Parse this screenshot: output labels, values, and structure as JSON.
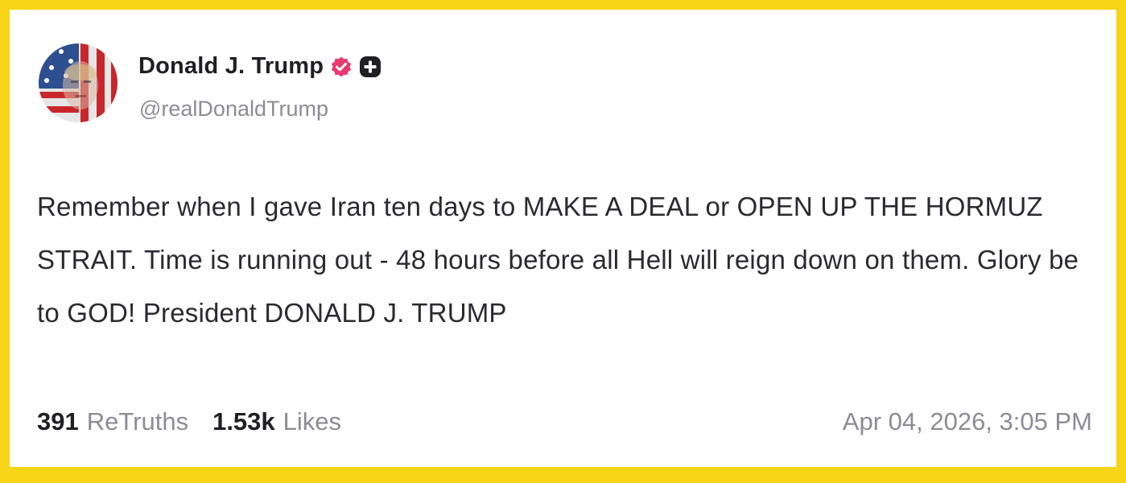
{
  "post": {
    "author_name": "Donald J. Trump",
    "author_handle": "@realDonaldTrump",
    "verified_icon": "verified-badge-icon",
    "subscribe_icon": "plus-icon",
    "avatar_icon": "profile-avatar",
    "body": "Remember when I gave Iran ten days to MAKE A DEAL or OPEN UP THE HORMUZ STRAIT. Time is running out - 48 hours before all Hell will reign down on them. Glory be to GOD! President DONALD J. TRUMP",
    "retruths_count": "391",
    "retruths_label": "ReTruths",
    "likes_count": "1.53k",
    "likes_label": "Likes",
    "timestamp": "Apr 04, 2026, 3:05 PM"
  },
  "colors": {
    "border": "#f5d516",
    "badge": "#e8386f",
    "text": "#1f1f24",
    "muted": "#8c8c95"
  }
}
